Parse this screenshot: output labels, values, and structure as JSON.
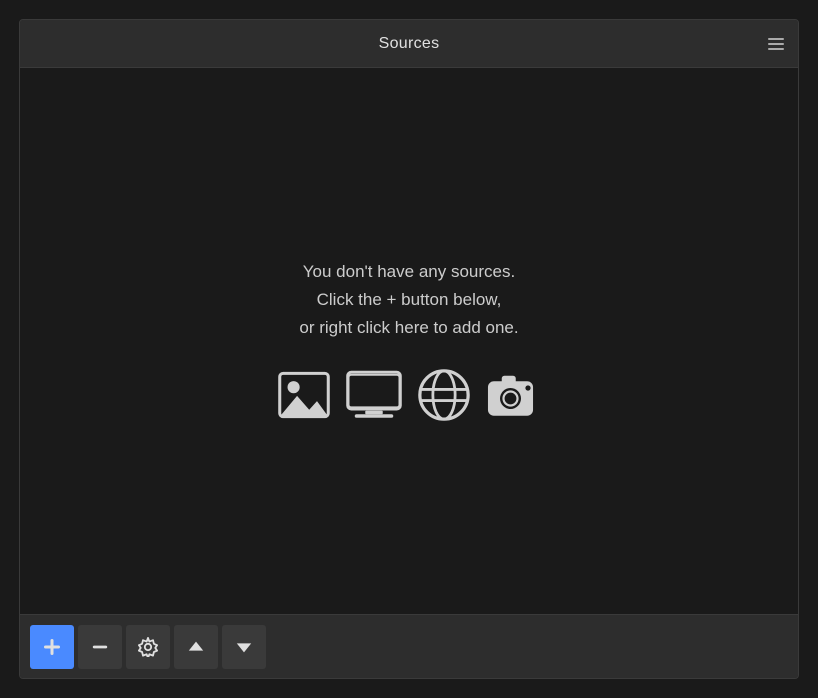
{
  "panel": {
    "title": "Sources",
    "empty_message_line1": "You don't have any sources.",
    "empty_message_line2": "Click the + button below,",
    "empty_message_line3": "or right click here to add one."
  },
  "footer": {
    "add_label": "+",
    "remove_label": "−",
    "settings_label": "⚙",
    "up_label": "∧",
    "down_label": "∨"
  },
  "icons": [
    {
      "name": "image-source-icon",
      "title": "Image"
    },
    {
      "name": "display-capture-icon",
      "title": "Display Capture"
    },
    {
      "name": "browser-source-icon",
      "title": "Browser"
    },
    {
      "name": "video-capture-icon",
      "title": "Video Capture"
    }
  ]
}
